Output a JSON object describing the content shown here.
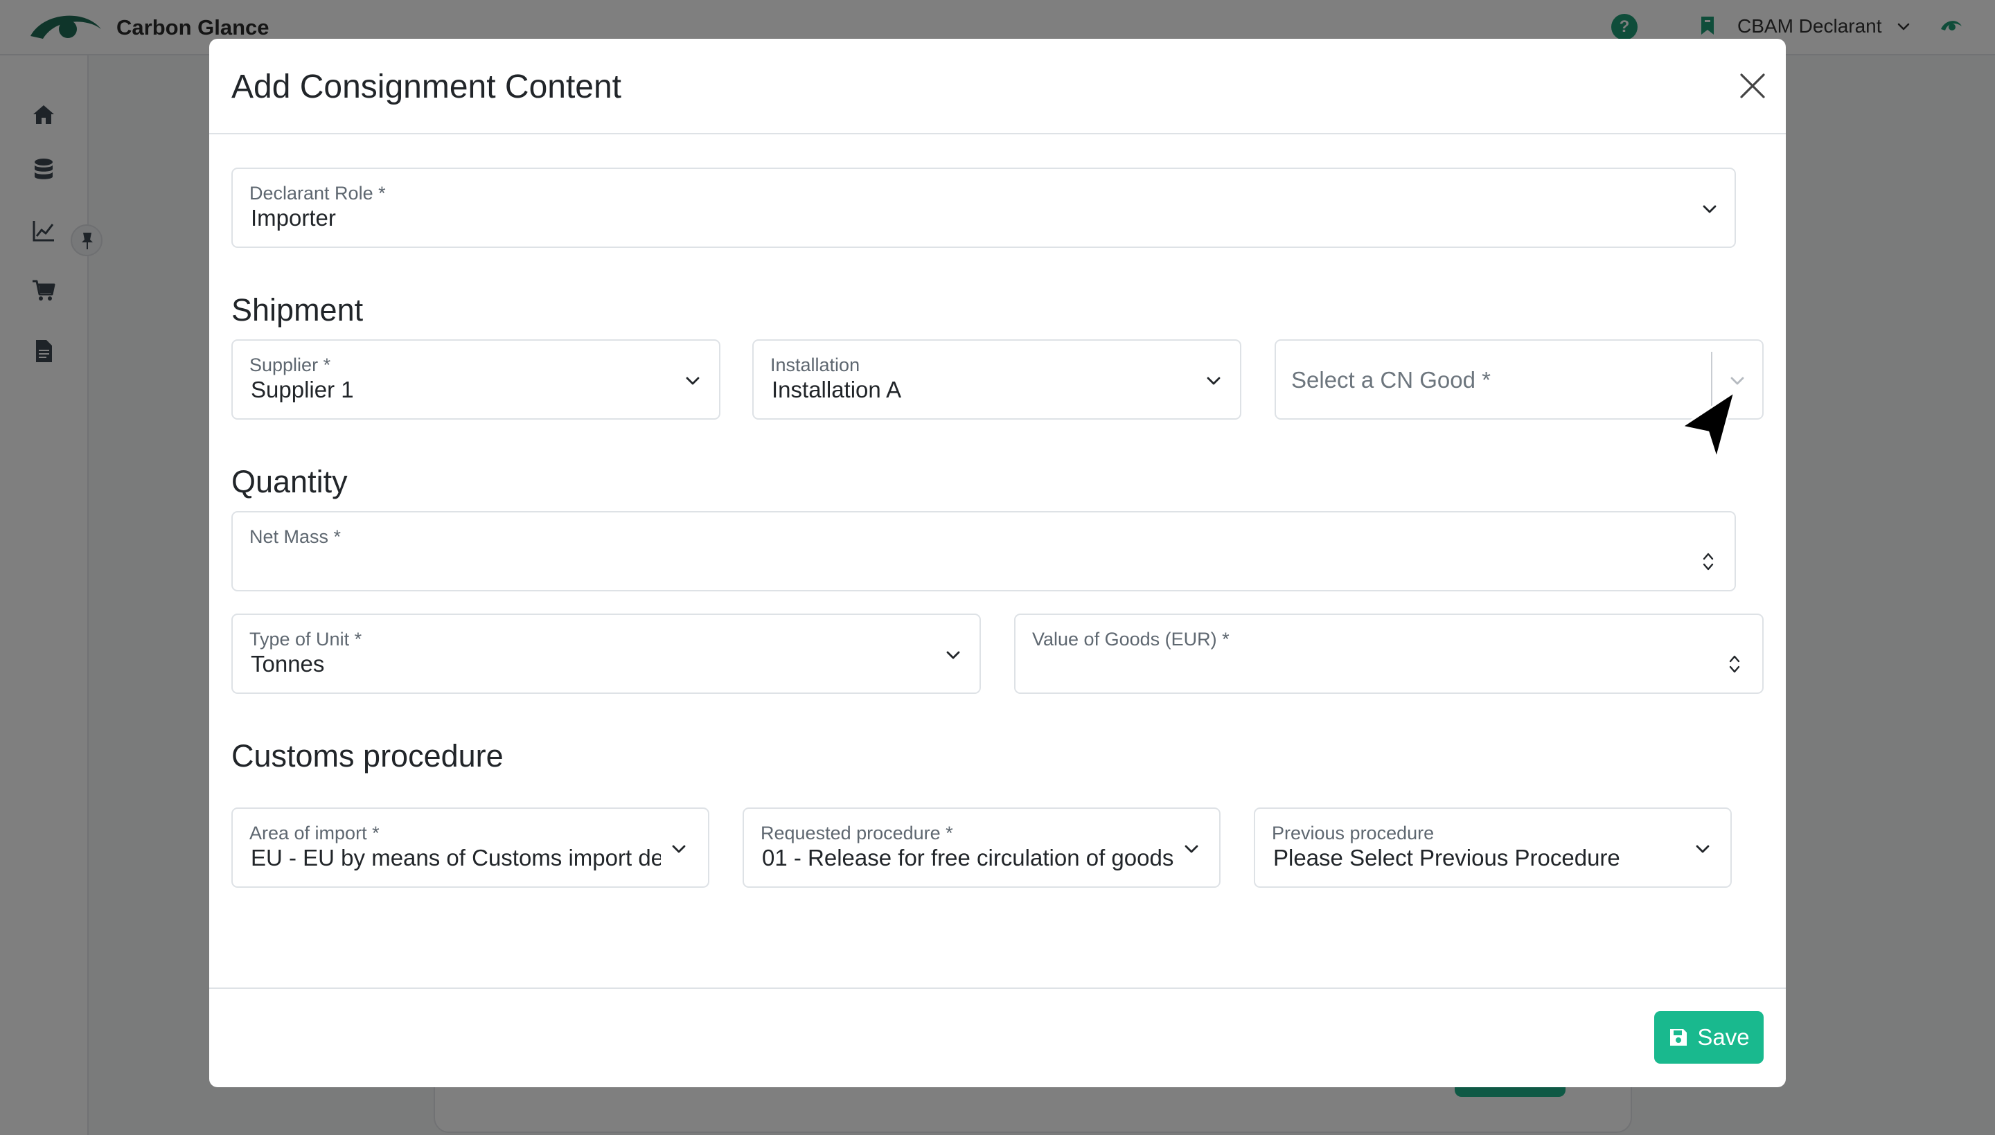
{
  "app": {
    "brand": "Carbon Glance",
    "account_label": "CBAM Declarant",
    "help_glyph": "?"
  },
  "modal": {
    "title": "Add Consignment Content",
    "declarant_role": {
      "label": "Declarant Role *",
      "value": "Importer"
    },
    "shipment": {
      "title": "Shipment",
      "supplier": {
        "label": "Supplier *",
        "value": "Supplier 1"
      },
      "installation": {
        "label": "Installation",
        "value": "Installation A"
      },
      "cn_good": {
        "placeholder": "Select a CN Good *"
      }
    },
    "quantity": {
      "title": "Quantity",
      "net_mass": {
        "label": "Net Mass *",
        "value": ""
      },
      "unit_type": {
        "label": "Type of Unit *",
        "value": "Tonnes"
      },
      "value_of_goods": {
        "label": "Value of Goods (EUR) *",
        "value": ""
      }
    },
    "customs": {
      "title": "Customs procedure",
      "area_of_import": {
        "label": "Area of import *",
        "value": "EU - EU by means of Customs import de"
      },
      "requested_procedure": {
        "label": "Requested procedure *",
        "value": "01 - Release for free circulation of goods"
      },
      "previous_procedure": {
        "label": "Previous procedure",
        "value": "Please Select Previous Procedure"
      }
    },
    "save_label": "Save"
  },
  "colors": {
    "brand_green": "#1f9a74",
    "save_button": "#19b98e",
    "border": "#dee2e6"
  },
  "icons": [
    "home-icon",
    "database-icon",
    "chart-icon",
    "cart-icon",
    "document-icon",
    "pin-icon",
    "close-icon",
    "chevron-down-icon",
    "spinner-icon",
    "save-icon",
    "cursor-icon",
    "help-icon",
    "bookmark-icon"
  ]
}
